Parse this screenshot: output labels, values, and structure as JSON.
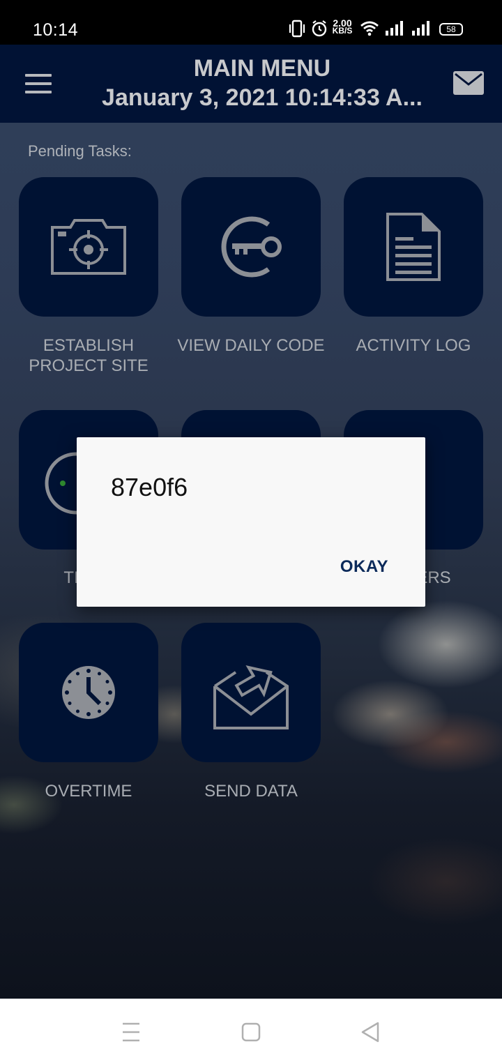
{
  "status_bar": {
    "time": "10:14",
    "net_speed_value": "2.00",
    "net_speed_unit": "KB/S",
    "battery": "58"
  },
  "app_bar": {
    "title": "MAIN MENU",
    "datetime": "January 3, 2021 10:14:33 A..."
  },
  "main": {
    "section_label": "Pending Tasks:",
    "tiles": [
      {
        "label_line1": "ESTABLISH",
        "label_line2": "PROJECT SITE",
        "icon": "camera-icon"
      },
      {
        "label": "VIEW DAILY CODE",
        "icon": "key-icon"
      },
      {
        "label": "ACTIVITY LOG",
        "icon": "document-icon"
      },
      {
        "label": "TI",
        "icon": "timer-icon"
      },
      {
        "label": "",
        "icon": "unknown-icon"
      },
      {
        "label": "ERS",
        "icon": "vehicle-icon"
      },
      {
        "label": "OVERTIME",
        "icon": "clock-icon"
      },
      {
        "label": "SEND DATA",
        "icon": "send-mail-icon"
      }
    ]
  },
  "dialog": {
    "message": "87e0f6",
    "ok_label": "OKAY"
  },
  "colors": {
    "app_bar": "#011234",
    "tile": "#001233",
    "dialog_button": "#0b2a5a"
  }
}
